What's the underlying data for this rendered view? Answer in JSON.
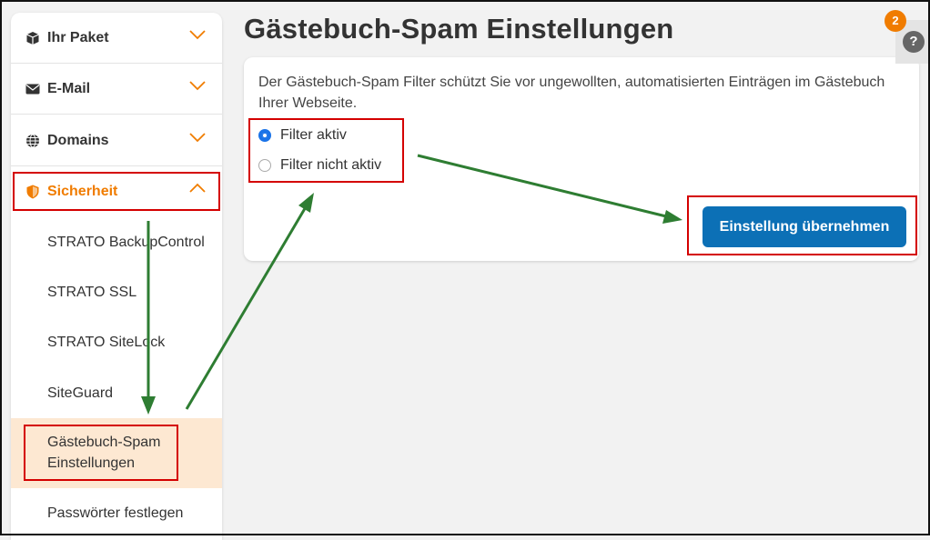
{
  "sidebar": {
    "items": [
      {
        "label": "Ihr Paket",
        "icon": "package-icon"
      },
      {
        "label": "E-Mail",
        "icon": "envelope-icon"
      },
      {
        "label": "Domains",
        "icon": "globe-icon"
      },
      {
        "label": "Sicherheit",
        "icon": "shield-icon",
        "expanded": true
      }
    ],
    "subitems": [
      {
        "label": "STRATO BackupControl"
      },
      {
        "label": "STRATO SSL"
      },
      {
        "label": "STRATO SiteLock"
      },
      {
        "label": "SiteGuard"
      },
      {
        "label": "Gästebuch-Spam Einstellungen",
        "line1": "Gästebuch-Spam",
        "line2": "Einstellungen",
        "current": true
      },
      {
        "label": "Passwörter festlegen"
      }
    ]
  },
  "main": {
    "title": "Gästebuch-Spam Einstellungen",
    "description": "Der Gästebuch-Spam Filter schützt Sie vor ungewollten, automatisierten Einträgen im Gästebuch Ihrer Webseite.",
    "options": [
      {
        "label": "Filter aktiv",
        "selected": true
      },
      {
        "label": "Filter nicht aktiv",
        "selected": false
      }
    ],
    "submit_label": "Einstellung übernehmen"
  },
  "help": {
    "badge_count": "2",
    "icon_glyph": "?"
  },
  "colors": {
    "accent": "#f07c00",
    "button": "#0c70b6",
    "highlight": "#d40000",
    "arrow": "#2e7d32",
    "current_bg": "#fde8d2"
  }
}
